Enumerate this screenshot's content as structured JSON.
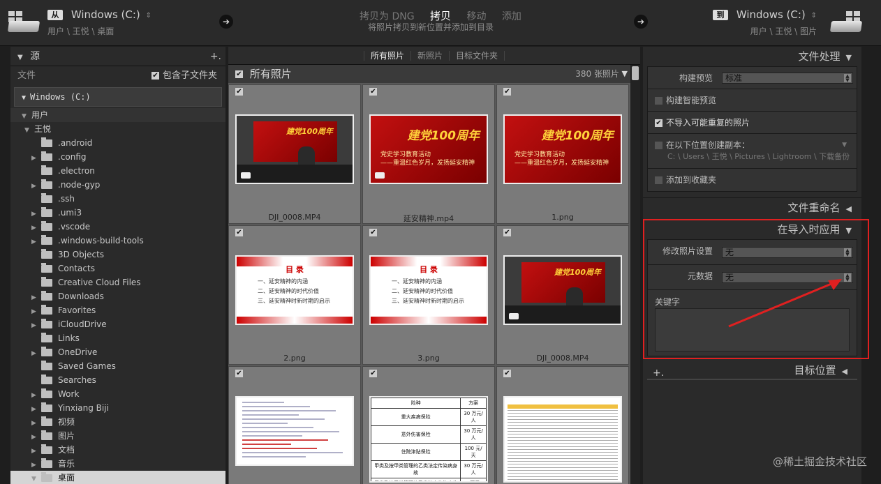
{
  "topbar": {
    "source_drive": "Windows (C:)",
    "source_path": "用户 \\ 王悦 \\ 桌面",
    "mode_tabs": [
      "拷贝为 DNG",
      "拷贝",
      "移动",
      "添加"
    ],
    "active_mode": "拷贝",
    "mode_subtitle": "将照片拷贝到新位置并添加到目录",
    "dest_drive": "Windows (C:)",
    "dest_path": "用户 \\ 王悦 \\ 图片",
    "source_badge": "从",
    "dest_badge": "到"
  },
  "left": {
    "title": "源",
    "add": "+.",
    "file_label": "文件",
    "include_sub": "包含子文件夹",
    "volume": "Windows (C:)",
    "users": "用户",
    "user": "王悦",
    "folders": [
      {
        "name": ".android",
        "exp": false
      },
      {
        "name": ".config",
        "exp": true
      },
      {
        "name": ".electron",
        "exp": false
      },
      {
        "name": ".node-gyp",
        "exp": true
      },
      {
        "name": ".ssh",
        "exp": false
      },
      {
        "name": ".umi3",
        "exp": true
      },
      {
        "name": ".vscode",
        "exp": true
      },
      {
        "name": ".windows-build-tools",
        "exp": true
      },
      {
        "name": "3D Objects",
        "exp": false
      },
      {
        "name": "Contacts",
        "exp": false
      },
      {
        "name": "Creative Cloud Files",
        "exp": false
      },
      {
        "name": "Downloads",
        "exp": true
      },
      {
        "name": "Favorites",
        "exp": true
      },
      {
        "name": "iCloudDrive",
        "exp": true
      },
      {
        "name": "Links",
        "exp": false
      },
      {
        "name": "OneDrive",
        "exp": true
      },
      {
        "name": "Saved Games",
        "exp": false
      },
      {
        "name": "Searches",
        "exp": false
      },
      {
        "name": "Work",
        "exp": true
      },
      {
        "name": "Yinxiang Biji",
        "exp": true
      },
      {
        "name": "视频",
        "exp": true
      },
      {
        "name": "图片",
        "exp": true
      },
      {
        "name": "文档",
        "exp": true
      },
      {
        "name": "音乐",
        "exp": true
      },
      {
        "name": "桌面",
        "exp": true,
        "selected": true
      }
    ]
  },
  "center": {
    "tabs": [
      "所有照片",
      "新照片",
      "目标文件夹"
    ],
    "header": "所有照片",
    "count": "380 张照片",
    "photos": [
      {
        "name": "DJI_0008.MP4",
        "kind": "projector"
      },
      {
        "name": "延安精神.mp4",
        "kind": "red"
      },
      {
        "name": "1.png",
        "kind": "red"
      },
      {
        "name": "2.png",
        "kind": "toc"
      },
      {
        "name": "3.png",
        "kind": "toc"
      },
      {
        "name": "DJI_0008.MP4",
        "kind": "projector"
      },
      {
        "name": "",
        "kind": "doc"
      },
      {
        "name": "",
        "kind": "tbl"
      },
      {
        "name": "",
        "kind": "sheet"
      }
    ],
    "red_title": "建党100周年",
    "red_text": [
      "党史学习教育活动",
      "——重温红色岁月，发扬延安精神"
    ],
    "toc_title": "目 录",
    "toc_items": [
      "一、延安精神的内涵",
      "二、延安精神的时代价值",
      "三、延安精神时新时期的启示"
    ],
    "table_rows": [
      [
        "险种",
        "方案"
      ],
      [
        "重大疾病保险",
        "30 万元/人"
      ],
      [
        "意外伤害保险",
        "30 万元/人"
      ],
      [
        "住院津贴保险",
        "100 元/天"
      ],
      [
        "甲类及按甲类管理的乙类法定传染病身故",
        "30 万元/人"
      ],
      [
        "甲类及按甲类管理的乙类法定传染病住院确诊津贴",
        "1 万元/人"
      ]
    ]
  },
  "right": {
    "file_handling": "文件处理",
    "build_preview_label": "构建预览",
    "build_preview_value": "标准",
    "smart_preview": "构建智能预览",
    "no_duplicates": "不导入可能重复的照片",
    "second_copy": "在以下位置创建副本：",
    "second_copy_path": "C: \\ Users \\ 王悦 \\ Pictures \\ Lightroom \\ 下载备份",
    "add_collection": "添加到收藏夹",
    "rename": "文件重命名",
    "apply": "在导入时应用",
    "develop_label": "修改照片设置",
    "develop_value": "无",
    "metadata_label": "元数据",
    "metadata_value": "无",
    "keywords_label": "关键字",
    "destination": "目标位置",
    "add_plus": "+."
  },
  "watermark": "@稀土掘金技术社区",
  "colors": {
    "highlight": "#e02020",
    "panel": "#2a2a2a",
    "grid": "#595959"
  }
}
